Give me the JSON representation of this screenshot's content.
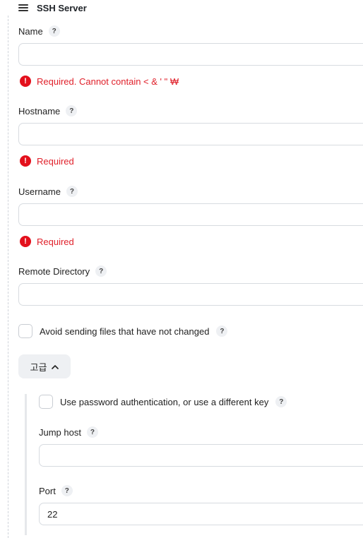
{
  "header": {
    "title": "SSH Server",
    "drag_icon": "hamburger-icon"
  },
  "fields": {
    "name": {
      "label": "Name",
      "value": "",
      "error": "Required. Cannot contain < & ' \" ₩"
    },
    "hostname": {
      "label": "Hostname",
      "value": "",
      "error": "Required"
    },
    "username": {
      "label": "Username",
      "value": "",
      "error": "Required"
    },
    "remote_directory": {
      "label": "Remote Directory",
      "value": ""
    },
    "avoid_sending": {
      "label": "Avoid sending files that have not changed",
      "checked": false
    }
  },
  "advanced": {
    "label": "고급",
    "chevron_icon": "chevron-up-icon",
    "use_password": {
      "label": "Use password authentication, or use a different key",
      "checked": false
    },
    "jump_host": {
      "label": "Jump host",
      "value": ""
    },
    "port": {
      "label": "Port",
      "value": "22"
    }
  },
  "help_glyph": "?",
  "error_glyph": "!"
}
